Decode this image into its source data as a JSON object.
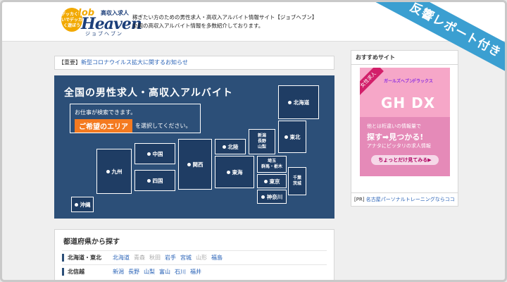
{
  "header": {
    "logo": {
      "badge_text": "デッカく稼いでデッカく遊ぼう",
      "job": "Job",
      "heaven": "Heaven",
      "tag1": "高収入求人",
      "tag2": "ジョブヘブン"
    },
    "tagline_line1": "稼ぎたい方のための男性求人・高収入アルバイト情報サイト【ジョブヘブン】",
    "tagline_line2": "全国の高収入アルバイト情報を多数紹介しております。"
  },
  "ribbon": "反響レポート付き",
  "notice": {
    "prefix": "【重要】",
    "link": "新型コロナウイルス拡大に関するお知らせ"
  },
  "map": {
    "title": "全国の男性求人・高収入アルバイト",
    "search_line": "お仕事が検索できます。",
    "button": "ご希望のエリア",
    "after": "を選択してください。",
    "regions": {
      "hokkaido": "北海道",
      "tohoku": "東北",
      "hokuriku": "北陸",
      "koshinetsu": [
        "新潟",
        "長野",
        "山梨"
      ],
      "kitakanto": [
        "埼玉",
        "群馬・栃木"
      ],
      "chiba": [
        "千葉",
        "茨城"
      ],
      "tokyo": "東京",
      "kanagawa": "神奈川",
      "tokai": "東海",
      "kansai": "関西",
      "chugoku": "中国",
      "shikoku": "四国",
      "kyushu": "九州",
      "okinawa": "沖縄"
    }
  },
  "pref": {
    "title": "都道府県から探す",
    "rows": [
      {
        "head": "北海道・東北",
        "items": [
          {
            "label": "北海道",
            "dim": false
          },
          {
            "label": "青森",
            "dim": true
          },
          {
            "label": "秋田",
            "dim": true
          },
          {
            "label": "岩手",
            "dim": false
          },
          {
            "label": "宮城",
            "dim": false
          },
          {
            "label": "山形",
            "dim": true
          },
          {
            "label": "福島",
            "dim": false
          }
        ]
      },
      {
        "head": "北信越",
        "items": [
          {
            "label": "新潟",
            "dim": false
          },
          {
            "label": "長野",
            "dim": false
          },
          {
            "label": "山梨",
            "dim": false
          },
          {
            "label": "富山",
            "dim": false
          },
          {
            "label": "石川",
            "dim": false
          },
          {
            "label": "福井",
            "dim": false
          }
        ]
      }
    ]
  },
  "side": {
    "title": "おすすめサイト",
    "banner": {
      "label": "女性求人",
      "top1": "ガールズヘブン",
      "top2": "デラックス",
      "gh": "GH DX",
      "l1": "他とは桁違いの情報量で",
      "l2": "探す➡見つかる!",
      "l3": "アナタにピッタリの求人情報",
      "cta": "ちょっとだけ見てみる▶"
    },
    "pr_prefix": "[PR]",
    "pr_link": "名古屋パーソナルトレーニングならココ"
  },
  "colors": {
    "map_bg": "#2c4f78",
    "accent_orange": "#f47a20",
    "link_blue": "#2a63b7",
    "ribbon_blue": "#3b9fd1"
  }
}
